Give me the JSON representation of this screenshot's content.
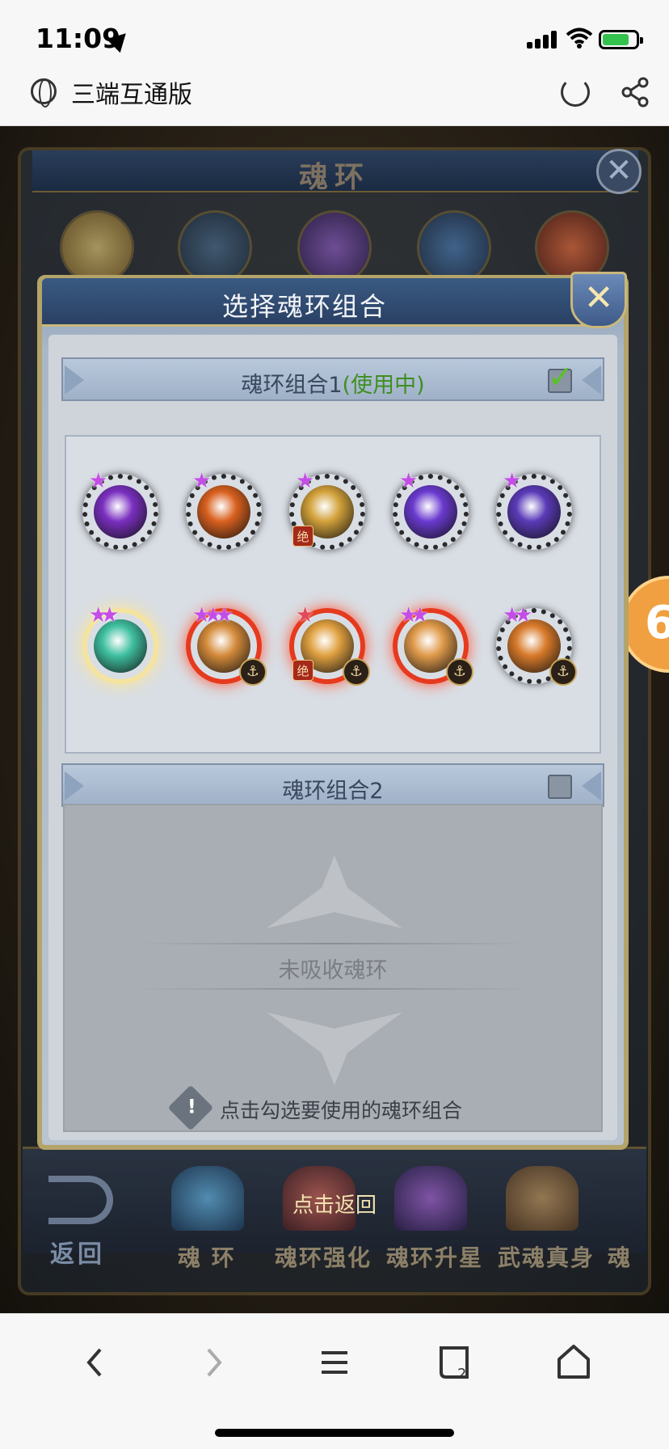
{
  "status_bar": {
    "time": "11:09"
  },
  "browser": {
    "site_title": "三端互通版"
  },
  "background": {
    "title": "魂环",
    "nav": {
      "back_label": "返回",
      "tabs": [
        "魂 环",
        "魂环强化",
        "魂环升星",
        "武魂真身",
        "魂"
      ],
      "return_hint": "点击返回"
    }
  },
  "side_badge": {
    "text": "6"
  },
  "modal": {
    "title": "选择魂环组合",
    "close_label": "✕",
    "combo1": {
      "label": "魂环组合1",
      "status": "(使用中)",
      "checked": true,
      "rings": [
        {
          "stars": 1,
          "jue": false,
          "anchor": false,
          "style": "dark",
          "color": "#7a2fc0"
        },
        {
          "stars": 1,
          "jue": false,
          "anchor": false,
          "style": "dark",
          "color": "#d9601e"
        },
        {
          "stars": 1,
          "jue": true,
          "anchor": false,
          "style": "dark",
          "color": "#d2a13a"
        },
        {
          "stars": 1,
          "jue": false,
          "anchor": false,
          "style": "dark",
          "color": "#6a3ad0"
        },
        {
          "stars": 1,
          "jue": false,
          "anchor": false,
          "style": "dark",
          "color": "#5a3ab8"
        },
        {
          "stars": 2,
          "jue": false,
          "anchor": false,
          "style": "gold",
          "color": "#3fc0a0"
        },
        {
          "stars": 3,
          "jue": false,
          "anchor": true,
          "style": "red",
          "color": "#d48a3a"
        },
        {
          "stars": 1,
          "jue": true,
          "anchor": true,
          "style": "red",
          "color": "#e0a040"
        },
        {
          "stars": 2,
          "jue": false,
          "anchor": true,
          "style": "red",
          "color": "#e09a4a"
        },
        {
          "stars": 2,
          "jue": false,
          "anchor": true,
          "style": "dark",
          "color": "#d87a2a"
        }
      ]
    },
    "combo2": {
      "label": "魂环组合2",
      "checked": false,
      "empty_text": "未吸收魂环"
    },
    "hint": "点击勾选要使用的魂环组合"
  },
  "toolbar": {
    "buttons": [
      "back",
      "forward",
      "menu",
      "tabs",
      "home"
    ],
    "tabs_count": "2"
  }
}
